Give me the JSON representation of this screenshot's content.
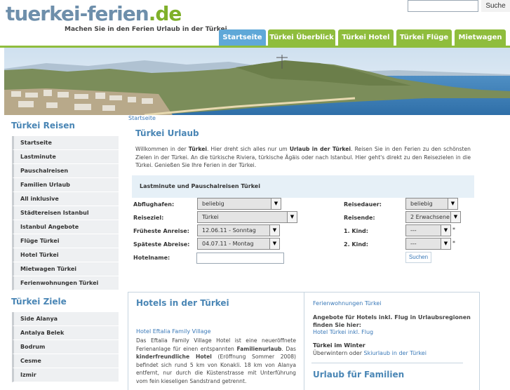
{
  "header": {
    "logo_part1": "tuerkei-ferien",
    "logo_part2": ".de",
    "tagline": "Machen Sie in den Ferien Urlaub in der Türkei.",
    "search_placeholder": "",
    "search_button": "Suche"
  },
  "nav": {
    "tabs": [
      "Startseite",
      "Türkei Überblick",
      "Türkei Hotel",
      "Türkei Flüge",
      "Mietwagen"
    ],
    "active": "Startseite"
  },
  "breadcrumb": "Startseite",
  "sidebar": {
    "heading1": "Türkei Reisen",
    "items1": [
      "Startseite",
      "Lastminute",
      "Pauschalreisen",
      "Familien Urlaub",
      "All inklusive",
      "Städtereisen Istanbul",
      "Istanbul Angebote",
      "Flüge Türkei",
      "Hotel Türkei",
      "Mietwagen Türkei",
      "Ferienwohnungen Türkei"
    ],
    "heading2": "Türkei Ziele",
    "items2": [
      "Side Alanya",
      "Antalya Belek",
      "Bodrum",
      "Cesme",
      "Izmir"
    ]
  },
  "main": {
    "title": "Türkei Urlaub",
    "intro_1": "Willkommen in der ",
    "intro_b1": "Türkei",
    "intro_2": ". Hier dreht sich alles nur um ",
    "intro_b2": "Urlaub in der Türkei",
    "intro_3": ". Reisen Sie in den Ferien zu den schönsten Zielen in der Türkei. An die türkische Riviera, türkische Ägäis oder nach Istanbul. Hier geht's direkt zu den Reisezielen in die Türkei. Genießen Sie Ihre Ferien in der Türkei."
  },
  "booking": {
    "title": "Lastminute und Pauschalreisen Türkei",
    "departure_label": "Abflughafen:",
    "departure_value": "beliebig",
    "destination_label": "Reiseziel:",
    "destination_value": "Türkei",
    "earliest_label": "Früheste Anreise:",
    "earliest_value": "12.06.11 - Sonntag",
    "latest_label": "Späteste Abreise:",
    "latest_value": "04.07.11 - Montag",
    "hotel_label": "Hotelname:",
    "duration_label": "Reisedauer:",
    "duration_value": "beliebig",
    "travellers_label": "Reisende:",
    "travellers_value": "2 Erwachsene",
    "child1_label": "1. Kind:",
    "child1_value": "---",
    "child2_label": "2. Kind:",
    "child2_value": "---",
    "star": "*",
    "submit": "Suchen"
  },
  "hotels": {
    "heading": "Hotels in der Türkei",
    "link": "Hotel Eftalia Family Village",
    "desc_1": "Das Eftalia Family Village Hotel ist eine neueröffnete Ferienanlage für einen entspannten ",
    "desc_b1": "Familienurlaub",
    "desc_2": ". Das ",
    "desc_b2": "kinderfreundliche Hotel",
    "desc_3": " (Eröffnung Sommer 2008) befindet sich rund 5 km von Konakli. 18 km von Alanya entfernt, nur durch die Küstenstrasse mit Unterführung vom fein kieseligen Sandstrand getrennt."
  },
  "right": {
    "fewo_link": "Ferienwohnungen Türkei",
    "angebote_text": "Angebote für Hotels inkl. Flug in Urlaubsregionen finden Sie hier:",
    "angebote_link": "Hotel Türkei inkl. Flug",
    "winter_title": "Türkei im Winter",
    "winter_text": "Überwintern oder ",
    "winter_link": "Skiurlaub in der Türkei",
    "familien_heading": "Urlaub für Familien"
  },
  "colors": {
    "accent_green": "#8fbd3d",
    "accent_blue": "#5fa8d8",
    "link_blue": "#3a79b8",
    "heading_blue": "#4a86b5"
  }
}
